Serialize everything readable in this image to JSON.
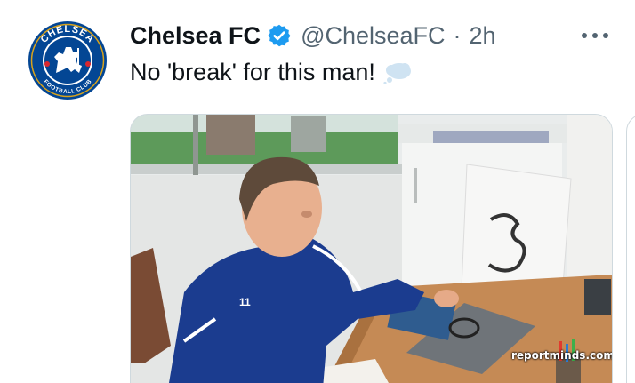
{
  "tweet": {
    "display_name": "Chelsea FC",
    "handle": "@ChelseaFC",
    "separator": "·",
    "time": "2h",
    "text": "No 'break' for this man!",
    "emoji": "thought-balloon",
    "verified": true
  },
  "avatar": {
    "logo_text_top": "CHELSEA",
    "logo_text_bottom": "FOOTBALL CLUB"
  },
  "media": {
    "shirt_number": "11",
    "watermark": "reportminds.com"
  },
  "colors": {
    "verified": "#1d9bf0",
    "chelsea_blue": "#034694",
    "text": "#0f1419",
    "muted": "#536471"
  },
  "icons": [
    "verified-badge-icon",
    "more-options-icon",
    "thought-balloon-emoji"
  ]
}
